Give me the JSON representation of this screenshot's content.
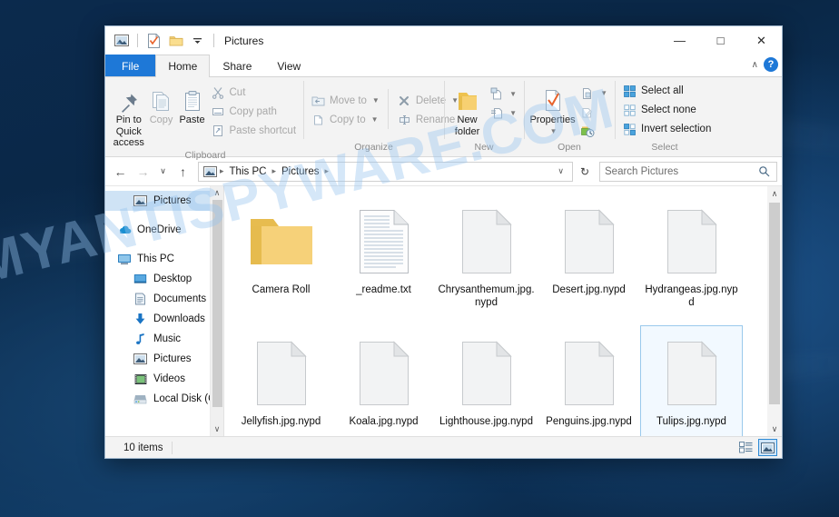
{
  "window": {
    "title": "Pictures",
    "quick_access": [
      "pictures-folder-icon",
      "properties-icon",
      "new-folder-icon",
      "customize-dropdown"
    ],
    "controls": {
      "minimize": "—",
      "maximize": "□",
      "close": "✕"
    }
  },
  "tabs": [
    {
      "label": "File",
      "id": "file"
    },
    {
      "label": "Home",
      "id": "home"
    },
    {
      "label": "Share",
      "id": "share"
    },
    {
      "label": "View",
      "id": "view"
    }
  ],
  "tab_right": {
    "collapse": "∧",
    "help": "?"
  },
  "ribbon": {
    "groups": [
      {
        "label": "Clipboard",
        "big": [
          {
            "label": "Pin to Quick access",
            "icon": "pin-icon",
            "dim": false
          },
          {
            "label": "Copy",
            "icon": "copy-icon",
            "dim": true
          },
          {
            "label": "Paste",
            "icon": "paste-icon",
            "dim": false
          }
        ],
        "small": [
          {
            "label": "Cut",
            "icon": "scissors-icon",
            "dim": true
          },
          {
            "label": "Copy path",
            "icon": "copy-path-icon",
            "dim": true
          },
          {
            "label": "Paste shortcut",
            "icon": "paste-shortcut-icon",
            "dim": true
          }
        ]
      },
      {
        "label": "Organize",
        "small_two_col": [
          {
            "label": "Move to",
            "icon": "move-to-icon",
            "dim": true,
            "caret": true
          },
          {
            "label": "Delete",
            "icon": "delete-x-icon",
            "dim": true,
            "caret": true
          },
          {
            "label": "Copy to",
            "icon": "copy-to-icon",
            "dim": true,
            "caret": true
          },
          {
            "label": "Rename",
            "icon": "rename-icon",
            "dim": true,
            "caret": false
          }
        ]
      },
      {
        "label": "New",
        "big": [
          {
            "label": "New folder",
            "icon": "new-folder-icon",
            "dim": false
          }
        ],
        "small": [
          {
            "label": "",
            "icon": "new-item-icon",
            "dim": true,
            "caret": true
          },
          {
            "label": "",
            "icon": "easy-access-icon",
            "dim": true,
            "caret": true
          }
        ]
      },
      {
        "label": "Open",
        "big": [
          {
            "label": "Properties",
            "icon": "properties-icon",
            "dim": false,
            "caret": true
          }
        ],
        "small": [
          {
            "label": "",
            "icon": "open-with-icon",
            "dim": true,
            "caret": true
          },
          {
            "label": "",
            "icon": "edit-icon",
            "dim": true,
            "caret": false
          },
          {
            "label": "",
            "icon": "history-icon",
            "dim": false,
            "caret": false
          }
        ]
      },
      {
        "label": "Select",
        "small": [
          {
            "label": "Select all",
            "icon": "select-all-icon",
            "dim": false
          },
          {
            "label": "Select none",
            "icon": "select-none-icon",
            "dim": false
          },
          {
            "label": "Invert selection",
            "icon": "invert-selection-icon",
            "dim": false
          }
        ]
      }
    ]
  },
  "address": {
    "back": "←",
    "forward": "→",
    "recent": "∨",
    "up": "↑",
    "crumbs": [
      "This PC",
      "Pictures"
    ],
    "crumb_dropdown": "∨",
    "refresh": "↻"
  },
  "search": {
    "placeholder": "Search Pictures",
    "value": "",
    "icon": "search-icon"
  },
  "sidebar": {
    "items": [
      {
        "label": "Pictures",
        "icon": "pictures-icon",
        "selected": true,
        "level": 1
      },
      {
        "label": "OneDrive",
        "icon": "onedrive-cloud-icon",
        "selected": false,
        "level": 0
      },
      {
        "label": "This PC",
        "icon": "this-pc-icon",
        "selected": false,
        "level": 0
      },
      {
        "label": "Desktop",
        "icon": "desktop-icon",
        "selected": false,
        "level": 1
      },
      {
        "label": "Documents",
        "icon": "documents-icon",
        "selected": false,
        "level": 1
      },
      {
        "label": "Downloads",
        "icon": "downloads-icon",
        "selected": false,
        "level": 1
      },
      {
        "label": "Music",
        "icon": "music-icon",
        "selected": false,
        "level": 1
      },
      {
        "label": "Pictures",
        "icon": "pictures-icon",
        "selected": false,
        "level": 1
      },
      {
        "label": "Videos",
        "icon": "videos-icon",
        "selected": false,
        "level": 1
      },
      {
        "label": "Local Disk (C:)",
        "icon": "local-disk-icon",
        "selected": false,
        "level": 1
      }
    ],
    "scroll_up": "∧",
    "scroll_down": "∨"
  },
  "files": [
    {
      "name": "Camera Roll",
      "type": "folder",
      "selected": false
    },
    {
      "name": "_readme.txt",
      "type": "text",
      "selected": false
    },
    {
      "name": "Chrysanthemum.jpg.nypd",
      "type": "blank",
      "selected": false
    },
    {
      "name": "Desert.jpg.nypd",
      "type": "blank",
      "selected": false
    },
    {
      "name": "Hydrangeas.jpg.nypd",
      "type": "blank",
      "selected": false
    },
    {
      "name": "Jellyfish.jpg.nypd",
      "type": "blank",
      "selected": false
    },
    {
      "name": "Koala.jpg.nypd",
      "type": "blank",
      "selected": false
    },
    {
      "name": "Lighthouse.jpg.nypd",
      "type": "blank",
      "selected": false
    },
    {
      "name": "Penguins.jpg.nypd",
      "type": "blank",
      "selected": false
    },
    {
      "name": "Tulips.jpg.nypd",
      "type": "blank",
      "selected": true
    }
  ],
  "status": {
    "item_count": "10 items",
    "views": [
      {
        "name": "details-view",
        "active": false
      },
      {
        "name": "large-icons-view",
        "active": true
      }
    ]
  },
  "watermark": {
    "text": "MYANTISPYWARE.COM"
  },
  "colors": {
    "accent": "#1e78d7",
    "selection": "#cfe3f5",
    "folder": "#f5cd6c",
    "watermark": "#96c3ee"
  }
}
